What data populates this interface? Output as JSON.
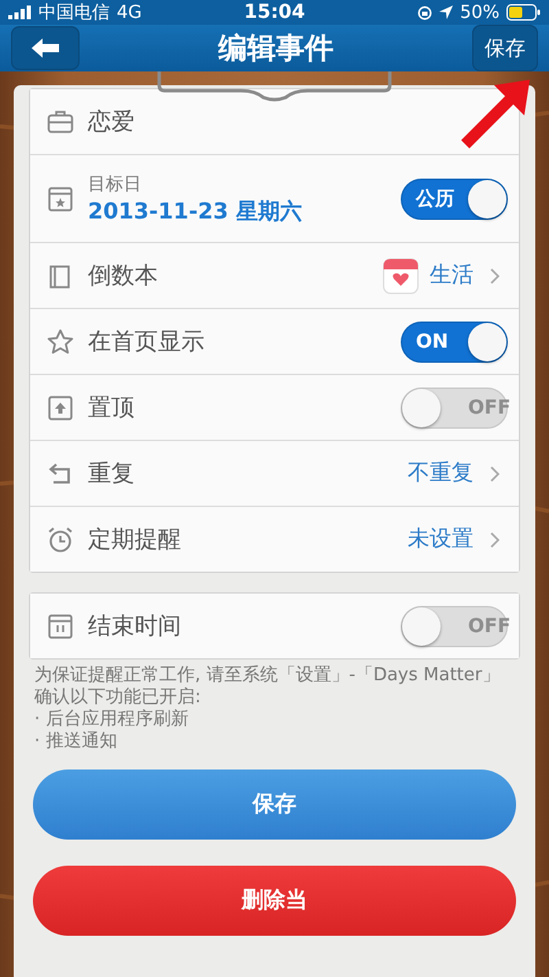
{
  "status_bar": {
    "carrier": "中国电信",
    "network": "4G",
    "time": "15:04",
    "battery": "50%"
  },
  "nav": {
    "title": "编辑事件",
    "action": "保存"
  },
  "groups": [
    {
      "rows": [
        {
          "kind": "plain",
          "label": "恋爱"
        },
        {
          "kind": "date",
          "label": "目标日",
          "value": "2013-11-23 星期六",
          "toggle": {
            "on": true,
            "label": "公历"
          }
        },
        {
          "kind": "link",
          "label": "倒数本",
          "value": "生活",
          "badge": true
        },
        {
          "kind": "toggle",
          "label": "在首页显示",
          "toggle": {
            "on": true,
            "label": "ON"
          }
        },
        {
          "kind": "toggle",
          "label": "置顶",
          "toggle": {
            "on": false,
            "label": "OFF"
          }
        },
        {
          "kind": "link",
          "label": "重复",
          "value": "不重复"
        },
        {
          "kind": "link",
          "label": "定期提醒",
          "value": "未设置"
        }
      ]
    },
    {
      "rows": [
        {
          "kind": "toggle",
          "label": "结束时间",
          "toggle": {
            "on": false,
            "label": "OFF"
          }
        }
      ]
    }
  ],
  "note": [
    "为保证提醒正常工作, 请至系统「设置」-「Days Matter」确认以下功能已开启:",
    "· 后台应用程序刷新",
    "· 推送通知"
  ],
  "buttons": [
    {
      "label": "保存",
      "kind": "primary"
    },
    {
      "label": "删除当",
      "kind": "danger"
    }
  ]
}
